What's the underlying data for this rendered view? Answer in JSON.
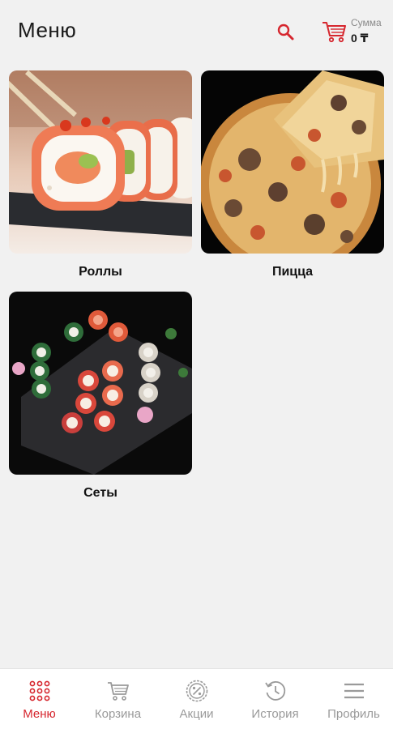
{
  "header": {
    "title": "Меню",
    "sum_label": "Сумма",
    "sum_value": "0 ₸"
  },
  "categories": [
    {
      "label": "Роллы"
    },
    {
      "label": "Пицца"
    },
    {
      "label": "Сеты"
    }
  ],
  "nav": [
    {
      "label": "Меню",
      "icon": "grid-icon",
      "active": true
    },
    {
      "label": "Корзина",
      "icon": "cart-icon",
      "active": false
    },
    {
      "label": "Акции",
      "icon": "percent-badge-icon",
      "active": false
    },
    {
      "label": "История",
      "icon": "history-icon",
      "active": false
    },
    {
      "label": "Профиль",
      "icon": "hamburger-icon",
      "active": false
    }
  ],
  "colors": {
    "accent": "#d6262e",
    "inactive": "#9a9a9a",
    "background": "#f1f1f1"
  }
}
